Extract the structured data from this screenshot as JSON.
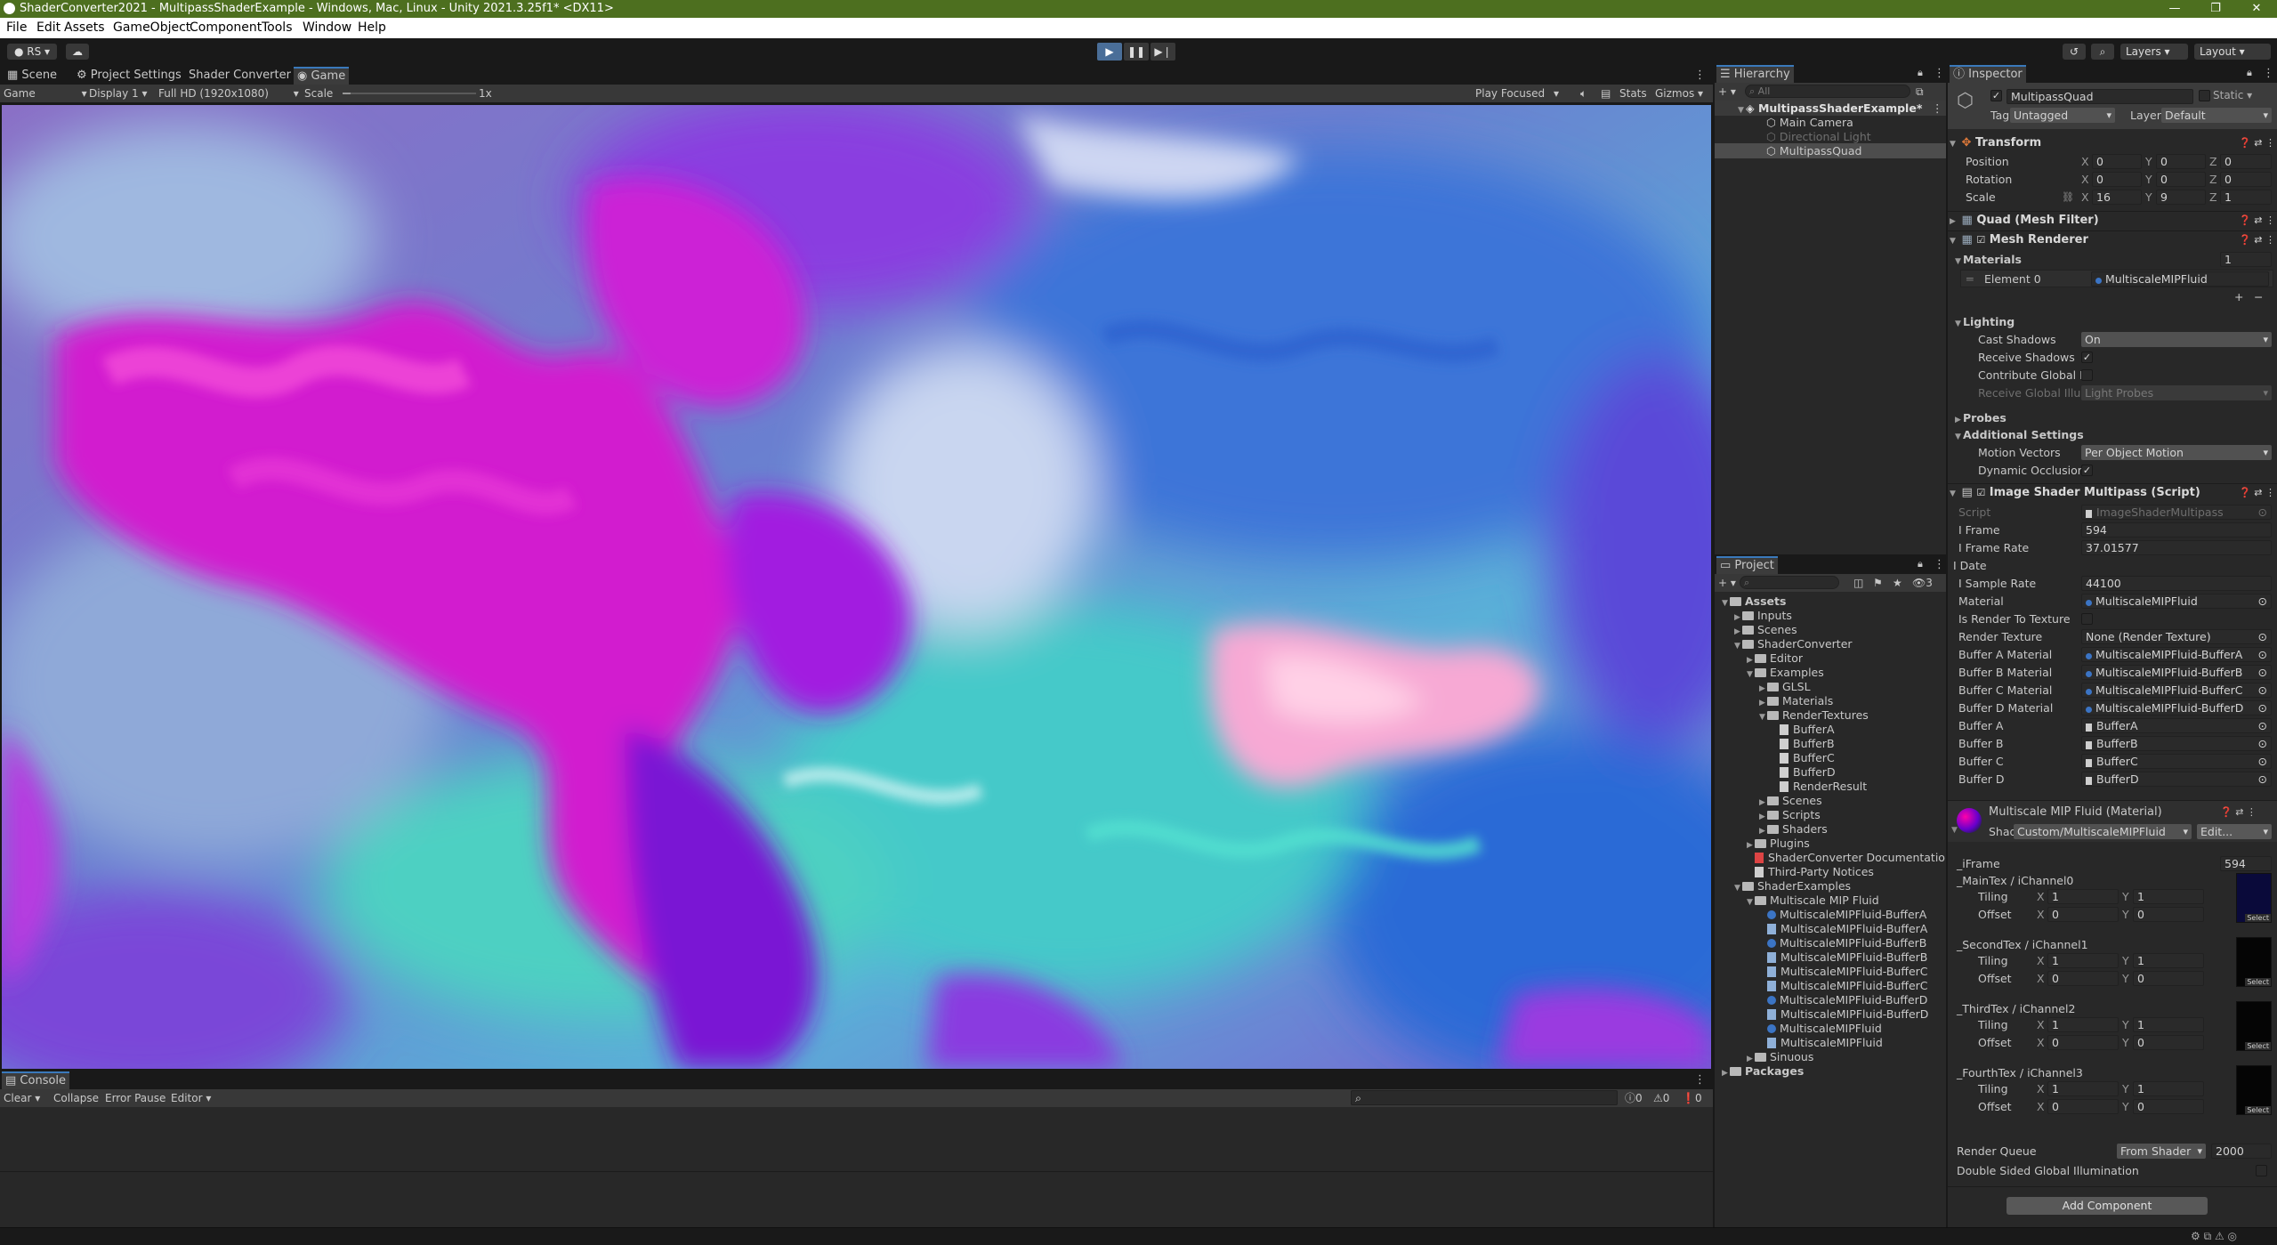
{
  "window": {
    "title": "ShaderConverter2021 - MultipassShaderExample - Windows, Mac, Linux - Unity 2021.3.25f1* <DX11>",
    "controls": [
      "—",
      "❐",
      "✕"
    ]
  },
  "menu": [
    "File",
    "Edit",
    "Assets",
    "GameObject",
    "Component",
    "Tools",
    "Window",
    "Help"
  ],
  "toolbar": {
    "account": "RS",
    "layers": "Layers",
    "layout": "Layout"
  },
  "game_view": {
    "tabs": [
      "Scene",
      "Project Settings",
      "Shader Converter",
      "Game"
    ],
    "game_dropdown": "Game",
    "display": "Display 1",
    "resolution": "Full HD (1920x1080)",
    "scale_label": "Scale",
    "scale_value": "1x",
    "play_focus": "Play Focused",
    "stats": "Stats",
    "gizmos": "Gizmos"
  },
  "hierarchy": {
    "title": "Hierarchy",
    "search_placeholder": "All",
    "items": [
      {
        "label": "MultipassShaderExample*"
      },
      {
        "label": "Main Camera"
      },
      {
        "label": "Directional Light"
      },
      {
        "label": "MultipassQuad"
      }
    ]
  },
  "inspector": {
    "title": "Inspector",
    "object_name": "MultipassQuad",
    "static_label": "Static",
    "tag_label": "Tag",
    "tag_value": "Untagged",
    "layer_label": "Layer",
    "layer_value": "Default",
    "transform": {
      "title": "Transform",
      "position": {
        "label": "Position",
        "x": "0",
        "y": "0",
        "z": "0"
      },
      "rotation": {
        "label": "Rotation",
        "x": "0",
        "y": "0",
        "z": "0"
      },
      "scale": {
        "label": "Scale",
        "x": "16",
        "y": "9",
        "z": "1"
      }
    },
    "mesh_filter": "Quad (Mesh Filter)",
    "mesh_renderer": {
      "title": "Mesh Renderer",
      "materials_label": "Materials",
      "materials_count": "1",
      "element0_label": "Element 0",
      "element0_value": "MultiscaleMIPFluid",
      "lighting": "Lighting",
      "cast_shadows_label": "Cast Shadows",
      "cast_shadows_value": "On",
      "receive_shadows_label": "Receive Shadows",
      "contribute_gi_label": "Contribute Global Ill",
      "receive_gi_label": "Receive Global Illum",
      "receive_gi_value": "Light Probes",
      "probes": "Probes",
      "additional": "Additional Settings",
      "motion_vectors_label": "Motion Vectors",
      "motion_vectors_value": "Per Object Motion",
      "dynamic_occlusion_label": "Dynamic Occlusion"
    },
    "script": {
      "title": "Image Shader Multipass (Script)",
      "fields": [
        {
          "label": "Script",
          "value": "ImageShaderMultipass"
        },
        {
          "label": "I Frame",
          "value": "594"
        },
        {
          "label": "I Frame Rate",
          "value": "37.01577"
        },
        {
          "label": "I Date",
          "value": ""
        },
        {
          "label": "I Sample Rate",
          "value": "44100"
        },
        {
          "label": "Material",
          "value": "MultiscaleMIPFluid"
        },
        {
          "label": "Is Render To Texture",
          "value": ""
        },
        {
          "label": "Render Texture",
          "value": "None (Render Texture)"
        },
        {
          "label": "Buffer A Material",
          "value": "MultiscaleMIPFluid-BufferA"
        },
        {
          "label": "Buffer B Material",
          "value": "MultiscaleMIPFluid-BufferB"
        },
        {
          "label": "Buffer C Material",
          "value": "MultiscaleMIPFluid-BufferC"
        },
        {
          "label": "Buffer D Material",
          "value": "MultiscaleMIPFluid-BufferD"
        },
        {
          "label": "Buffer A",
          "value": "BufferA"
        },
        {
          "label": "Buffer B",
          "value": "BufferB"
        },
        {
          "label": "Buffer C",
          "value": "BufferC"
        },
        {
          "label": "Buffer D",
          "value": "BufferD"
        }
      ]
    },
    "material": {
      "title": "Multiscale MIP Fluid (Material)",
      "shader_label": "Shader",
      "shader_value": "Custom/MultiscaleMIPFluid",
      "edit_label": "Edit...",
      "iframe_label": "_iFrame",
      "iframe_value": "594",
      "textures": [
        {
          "name": "_MainTex / iChannel0",
          "tiling_x": "1",
          "tiling_y": "1",
          "offset_x": "0",
          "offset_y": "0"
        },
        {
          "name": "_SecondTex / iChannel1",
          "tiling_x": "1",
          "tiling_y": "1",
          "offset_x": "0",
          "offset_y": "0"
        },
        {
          "name": "_ThirdTex / iChannel2",
          "tiling_x": "1",
          "tiling_y": "1",
          "offset_x": "0",
          "offset_y": "0"
        },
        {
          "name": "_FourthTex / iChannel3",
          "tiling_x": "1",
          "tiling_y": "1",
          "offset_x": "0",
          "offset_y": "0"
        }
      ],
      "tiling_label": "Tiling",
      "offset_label": "Offset",
      "select_label": "Select",
      "render_queue_label": "Render Queue",
      "render_queue_mode": "From Shader",
      "render_queue_value": "2000",
      "double_sided_label": "Double Sided Global Illumination"
    },
    "add_component": "Add Component"
  },
  "project": {
    "title": "Project",
    "badge": "3",
    "tree": [
      {
        "label": "Assets",
        "type": "folder",
        "depth": 0,
        "bold": true
      },
      {
        "label": "Inputs",
        "type": "folder",
        "depth": 1
      },
      {
        "label": "Scenes",
        "type": "folder",
        "depth": 1
      },
      {
        "label": "ShaderConverter",
        "type": "folder",
        "depth": 1
      },
      {
        "label": "Editor",
        "type": "folder",
        "depth": 2
      },
      {
        "label": "Examples",
        "type": "folder",
        "depth": 2
      },
      {
        "label": "GLSL",
        "type": "folder",
        "depth": 3
      },
      {
        "label": "Materials",
        "type": "folder",
        "depth": 3
      },
      {
        "label": "RenderTextures",
        "type": "folder",
        "depth": 3
      },
      {
        "label": "BufferA",
        "type": "file",
        "depth": 4
      },
      {
        "label": "BufferB",
        "type": "file",
        "depth": 4
      },
      {
        "label": "BufferC",
        "type": "file",
        "depth": 4
      },
      {
        "label": "BufferD",
        "type": "file",
        "depth": 4
      },
      {
        "label": "RenderResult",
        "type": "file",
        "depth": 4
      },
      {
        "label": "Scenes",
        "type": "folder",
        "depth": 3
      },
      {
        "label": "Scripts",
        "type": "folder",
        "depth": 3
      },
      {
        "label": "Shaders",
        "type": "folder",
        "depth": 3
      },
      {
        "label": "Plugins",
        "type": "folder",
        "depth": 2
      },
      {
        "label": "ShaderConverter Documentation",
        "type": "doc",
        "depth": 2
      },
      {
        "label": "Third-Party Notices",
        "type": "file",
        "depth": 2
      },
      {
        "label": "ShaderExamples",
        "type": "folder",
        "depth": 1
      },
      {
        "label": "Multiscale MIP Fluid",
        "type": "folder",
        "depth": 2
      },
      {
        "label": "MultiscaleMIPFluid-BufferA",
        "type": "mat",
        "depth": 3
      },
      {
        "label": "MultiscaleMIPFluid-BufferA",
        "type": "shader",
        "depth": 3
      },
      {
        "label": "MultiscaleMIPFluid-BufferB",
        "type": "mat",
        "depth": 3
      },
      {
        "label": "MultiscaleMIPFluid-BufferB",
        "type": "shader",
        "depth": 3
      },
      {
        "label": "MultiscaleMIPFluid-BufferC",
        "type": "shader",
        "depth": 3
      },
      {
        "label": "MultiscaleMIPFluid-BufferC",
        "type": "shader",
        "depth": 3
      },
      {
        "label": "MultiscaleMIPFluid-BufferD",
        "type": "mat",
        "depth": 3
      },
      {
        "label": "MultiscaleMIPFluid-BufferD",
        "type": "shader",
        "depth": 3
      },
      {
        "label": "MultiscaleMIPFluid",
        "type": "mat",
        "depth": 3
      },
      {
        "label": "MultiscaleMIPFluid",
        "type": "shader",
        "depth": 3
      },
      {
        "label": "Sinuous",
        "type": "folder",
        "depth": 2
      },
      {
        "label": "Packages",
        "type": "folder",
        "depth": 0,
        "bold": true
      }
    ]
  },
  "console": {
    "title": "Console",
    "clear": "Clear",
    "collapse": "Collapse",
    "error_pause": "Error Pause",
    "editor": "Editor",
    "count_log": "0",
    "count_warn": "0",
    "count_error": "0"
  },
  "colors": {
    "titlebar": "#4d6f1f",
    "accent": "#3a79bb",
    "panel": "#282828",
    "dark": "#191919"
  }
}
